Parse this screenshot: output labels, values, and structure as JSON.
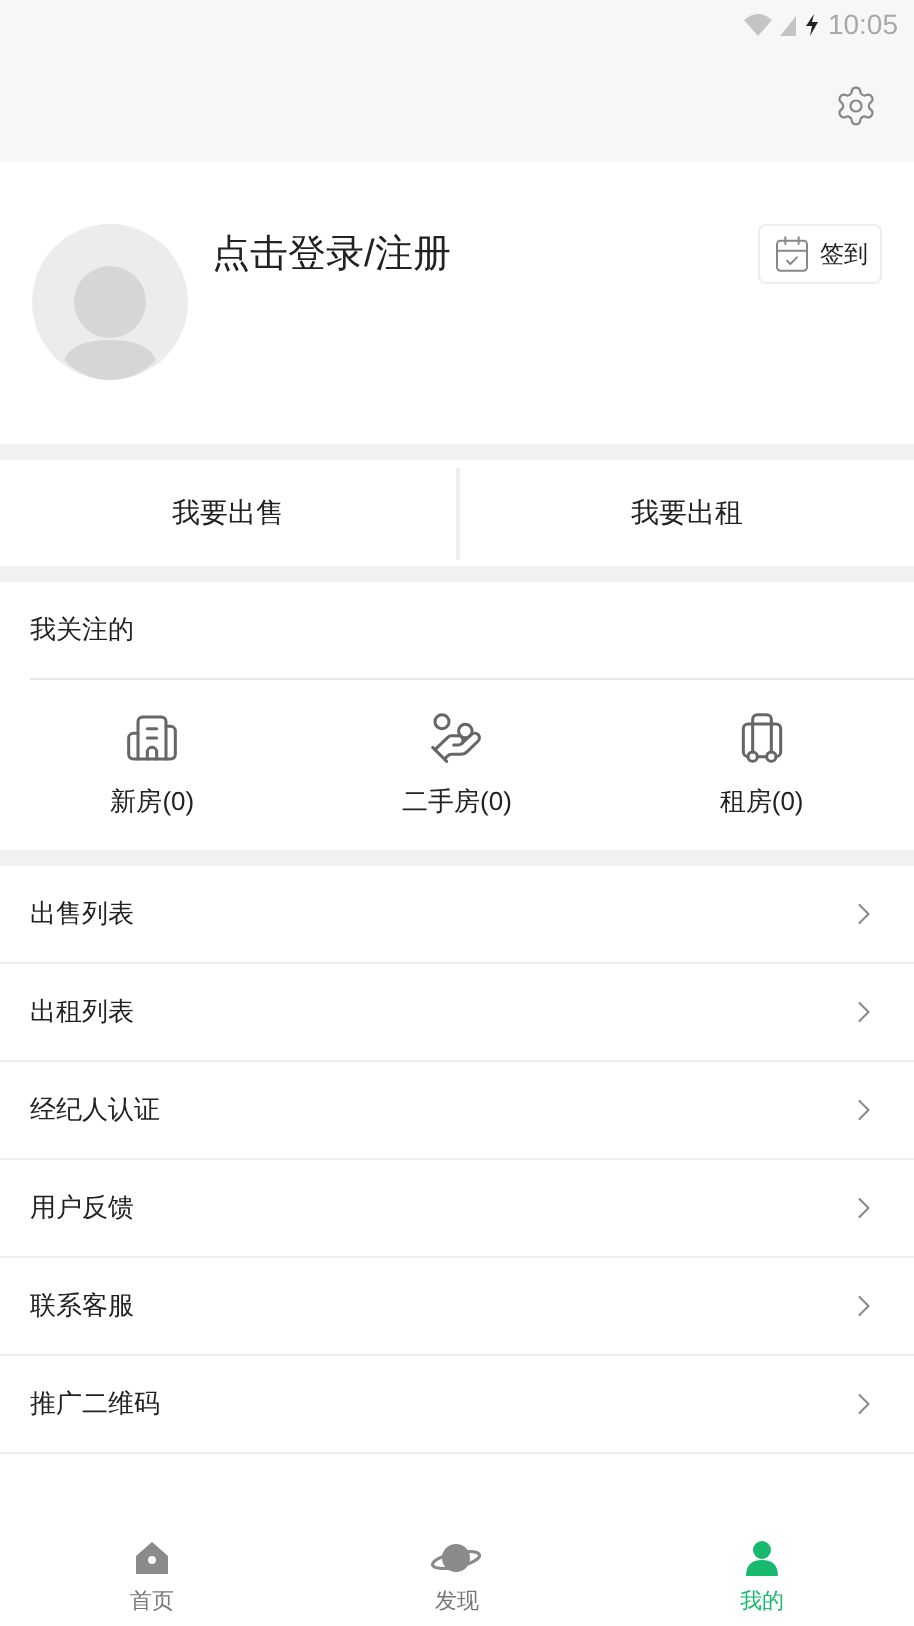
{
  "status_bar": {
    "time": "10:05"
  },
  "profile": {
    "login": "点击登录/注册",
    "checkin": "签到"
  },
  "actions": [
    "我要出售",
    "我要出租"
  ],
  "follow": {
    "title": "我关注的",
    "items": [
      {
        "kind": "building",
        "label": "新房(0)"
      },
      {
        "kind": "hand",
        "label": "二手房(0)"
      },
      {
        "kind": "luggage",
        "label": "租房(0)"
      }
    ]
  },
  "menu": [
    "出售列表",
    "出租列表",
    "经纪人认证",
    "用户反馈",
    "联系客服",
    "推广二维码"
  ],
  "tabs": [
    {
      "kind": "home",
      "label": "首页",
      "selected": false
    },
    {
      "kind": "planet",
      "label": "发现",
      "selected": false
    },
    {
      "kind": "user",
      "label": "我的",
      "selected": true
    }
  ]
}
